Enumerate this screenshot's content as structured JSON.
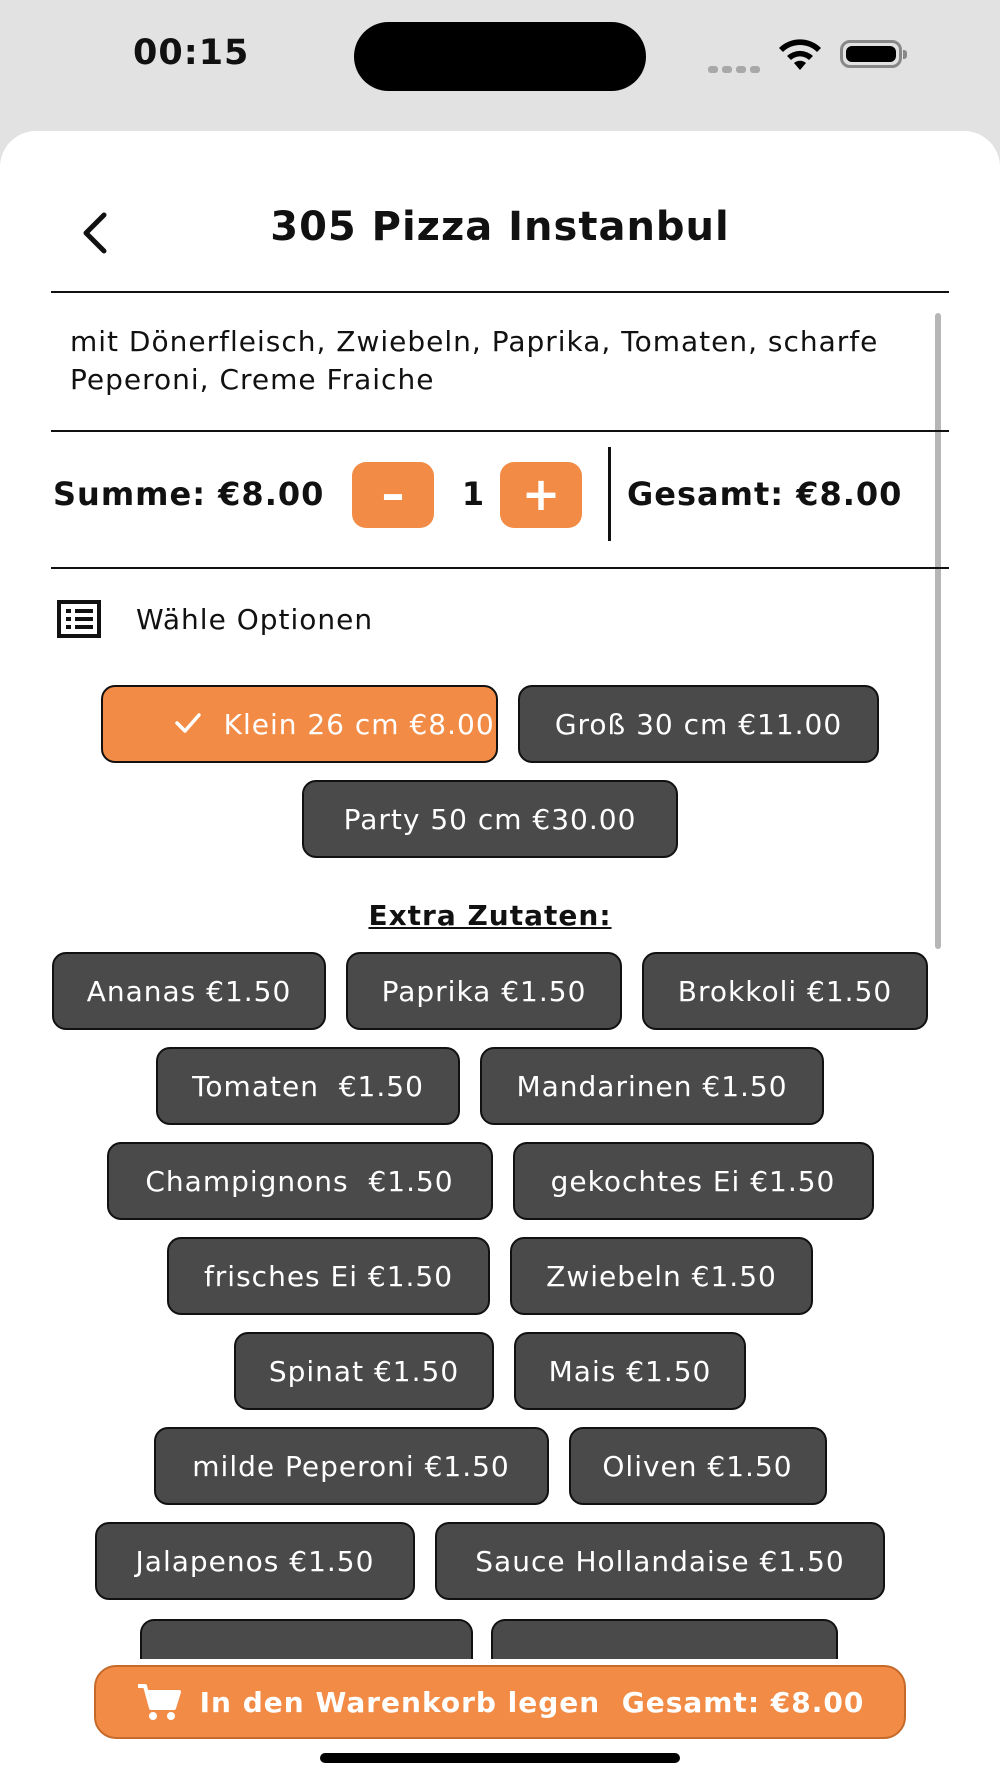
{
  "status": {
    "time": "00:15"
  },
  "header": {
    "title": "305 Pizza Instanbul"
  },
  "description": "mit Dönerfleisch, Zwiebeln, Paprika, Tomaten, scharfe Peperoni, Creme Fraiche",
  "quantity_row": {
    "summe": "Summe: €8.00",
    "minus": "–",
    "quantity": "1",
    "plus": "+",
    "gesamt": "Gesamt: €8.00"
  },
  "options": {
    "label": "Wähle Optionen",
    "sizes": [
      {
        "label": "Klein 26 cm €8.00",
        "selected": true
      },
      {
        "label": "Groß 30 cm €11.00",
        "selected": false
      },
      {
        "label": "Party 50 cm €30.00",
        "selected": false
      }
    ]
  },
  "extras": {
    "title": "Extra Zutaten:",
    "items": [
      "Ananas €1.50",
      "Paprika €1.50",
      "Brokkoli €1.50",
      "Tomaten  €1.50",
      "Mandarinen €1.50",
      "Champignons  €1.50",
      "gekochtes Ei €1.50",
      "frisches Ei €1.50",
      "Zwiebeln €1.50",
      "Spinat €1.50",
      "Mais €1.50",
      "milde Peperoni €1.50",
      "Oliven €1.50",
      "Jalapenos €1.50",
      "Sauce Hollandaise €1.50"
    ]
  },
  "cart_button": {
    "label": "In den Warenkorb legen  Gesamt: €8.00"
  },
  "colors": {
    "accent": "#f28b45",
    "chip": "#4a4a4a"
  }
}
